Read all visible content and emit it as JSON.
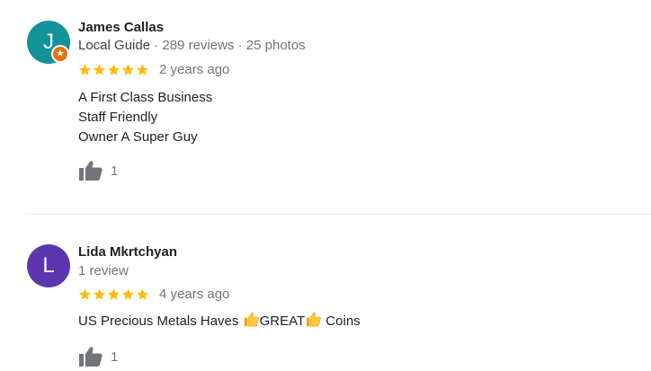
{
  "colors": {
    "star": "#fbbc04",
    "avatar_j": "#12939a",
    "avatar_l": "#5e35b1",
    "guide_badge": "#e8710a",
    "thumb": "#70757a"
  },
  "reviews": [
    {
      "avatar_letter": "J",
      "name": "James Callas",
      "guide_label": "Local Guide",
      "separator": "·",
      "reviews_count": "289 reviews",
      "photos_count": "25 photos",
      "rating": 5,
      "date": "2 years ago",
      "text_lines": [
        "A First Class Business",
        "Staff Friendly",
        "Owner A Super Guy"
      ],
      "likes": "1"
    },
    {
      "avatar_letter": "L",
      "name": "Lida Mkrtchyan",
      "reviews_count": "1 review",
      "rating": 5,
      "date": "4 years ago",
      "text_parts": [
        "US Precious Metals Haves ",
        "GREAT",
        " Coins"
      ],
      "emoji": "thumbs-up-emoji",
      "likes": "1"
    }
  ]
}
